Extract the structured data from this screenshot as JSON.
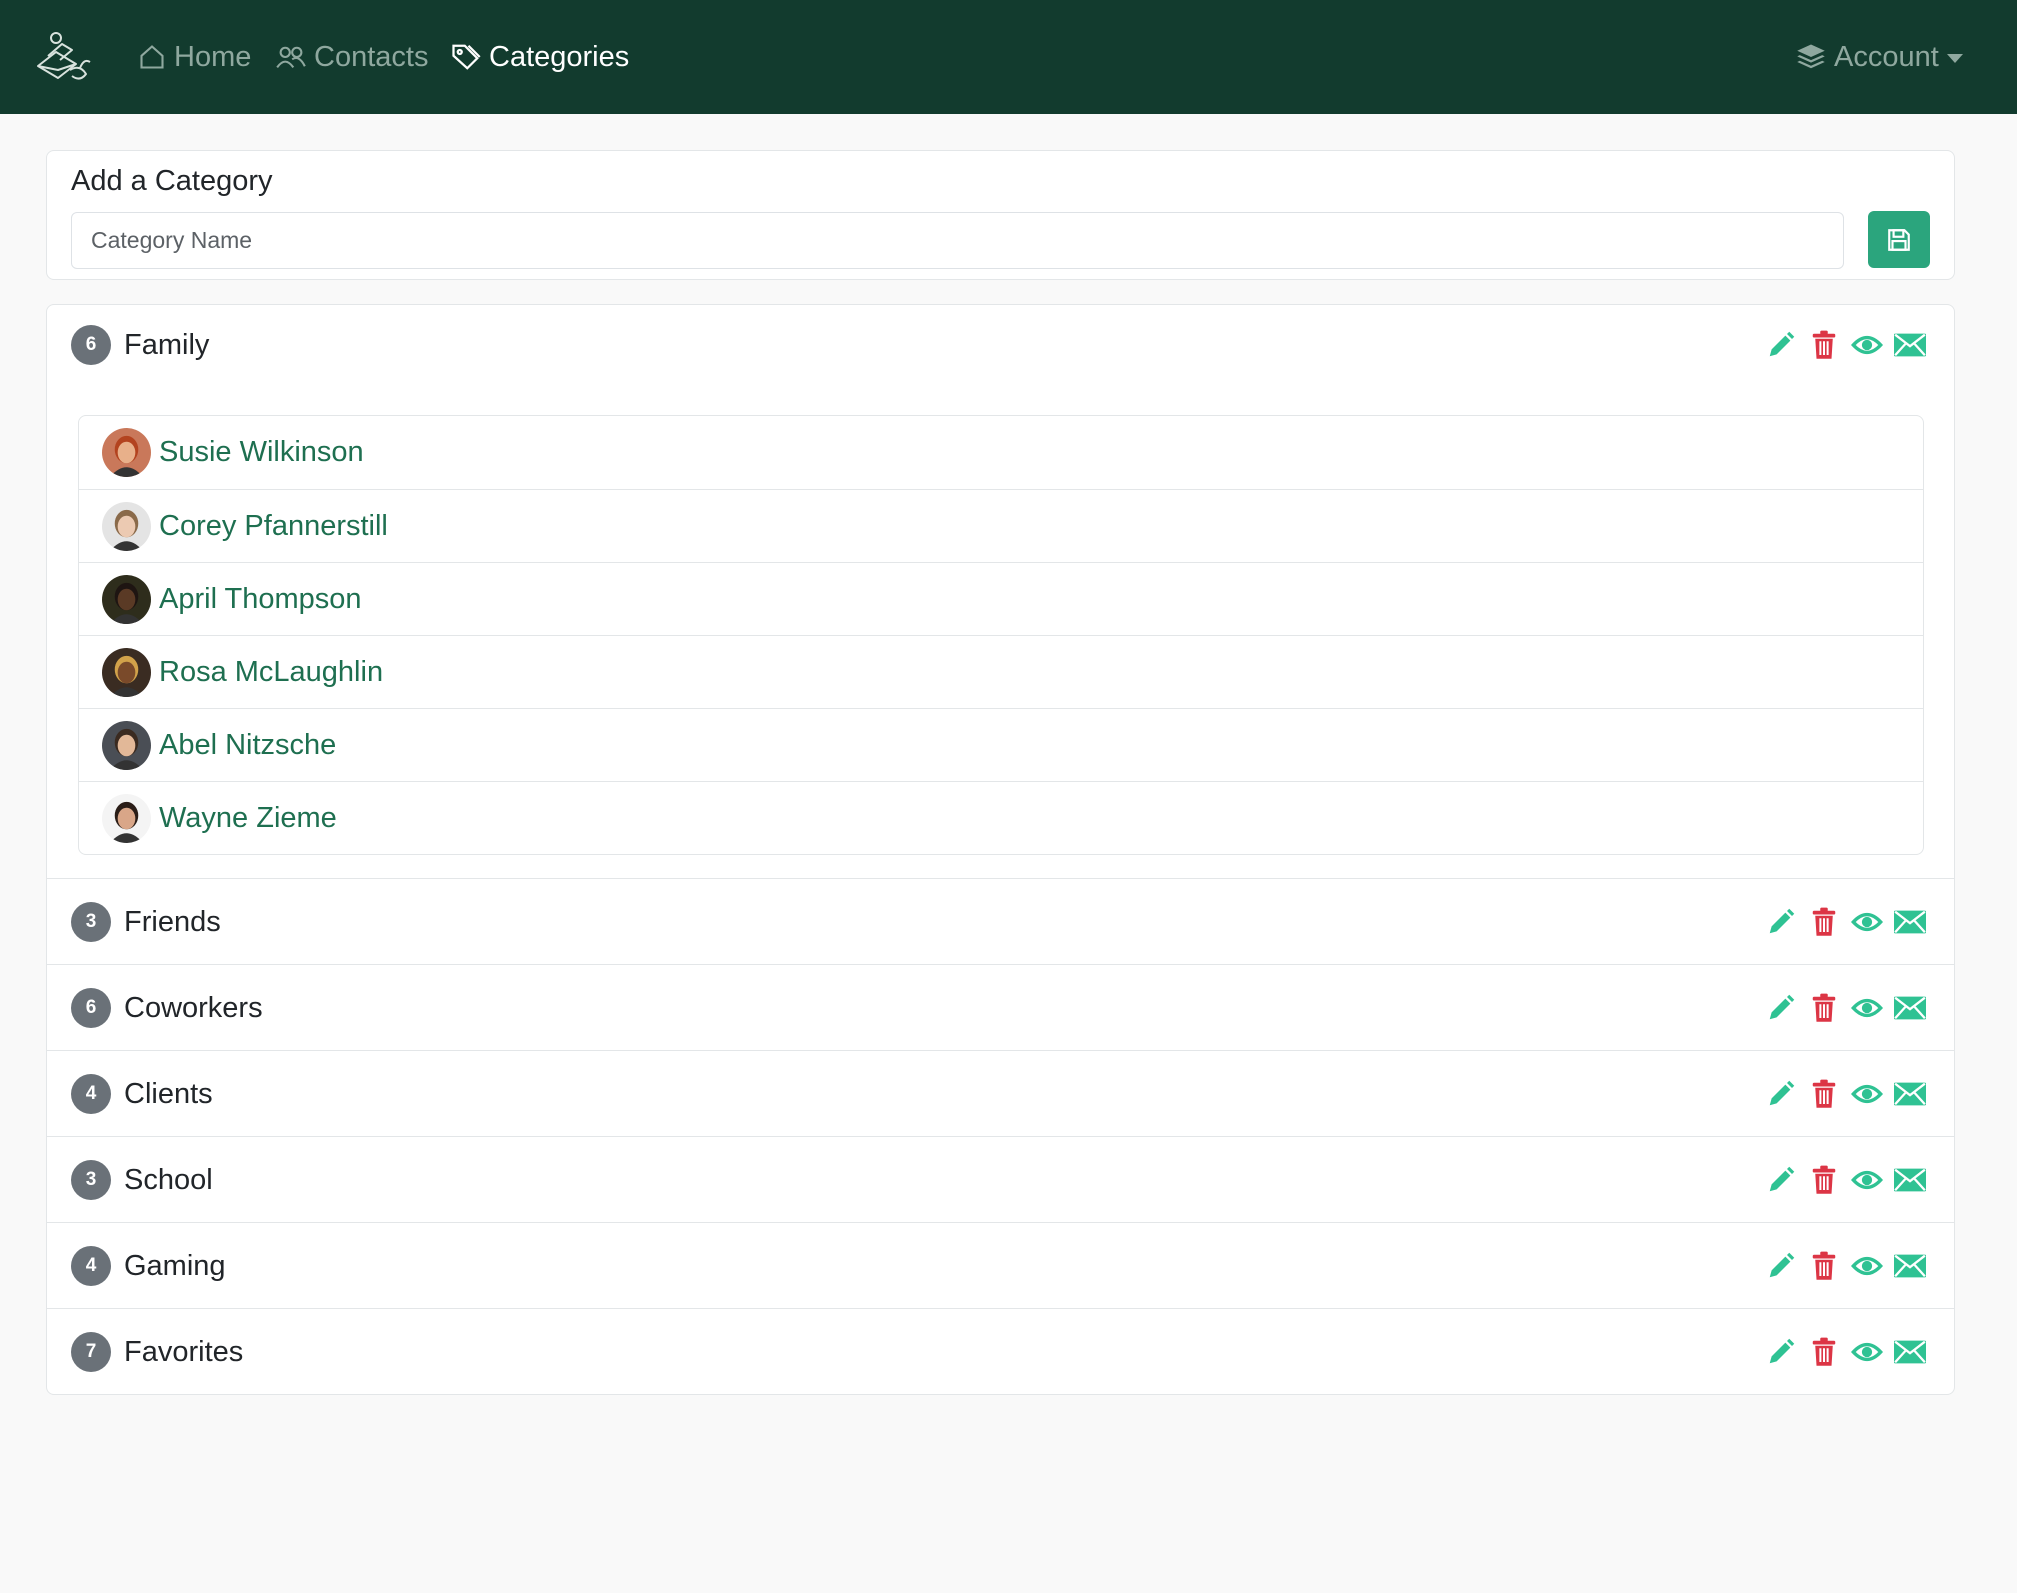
{
  "nav": {
    "home": "Home",
    "contacts": "Contacts",
    "categories": "Categories",
    "account": "Account"
  },
  "add_category": {
    "title": "Add a Category",
    "placeholder": "Category Name",
    "value": ""
  },
  "categories": [
    {
      "name": "Family",
      "count": "6",
      "expanded": true,
      "contacts": [
        {
          "name": "Susie Wilkinson",
          "skin": "#e8b08a",
          "hair": "#b3431f",
          "bg": "#c9785a"
        },
        {
          "name": "Corey Pfannerstill",
          "skin": "#eccab2",
          "hair": "#8a6a4a",
          "bg": "#e4e4e4"
        },
        {
          "name": "April Thompson",
          "skin": "#5a3a25",
          "hair": "#1e1512",
          "bg": "#2e2d1c"
        },
        {
          "name": "Rosa McLaughlin",
          "skin": "#7a4a2a",
          "hair": "#d2a24a",
          "bg": "#3a2c22"
        },
        {
          "name": "Abel Nitzsche",
          "skin": "#e2b898",
          "hair": "#3a2a20",
          "bg": "#4a4e55"
        },
        {
          "name": "Wayne Zieme",
          "skin": "#d9a688",
          "hair": "#2a1d17",
          "bg": "#f4f4f4"
        }
      ]
    },
    {
      "name": "Friends",
      "count": "3",
      "expanded": false
    },
    {
      "name": "Coworkers",
      "count": "6",
      "expanded": false
    },
    {
      "name": "Clients",
      "count": "4",
      "expanded": false
    },
    {
      "name": "School",
      "count": "3",
      "expanded": false
    },
    {
      "name": "Gaming",
      "count": "4",
      "expanded": false
    },
    {
      "name": "Favorites",
      "count": "7",
      "expanded": false
    }
  ],
  "icons": {
    "edit": "pencil-icon",
    "delete": "trash-icon",
    "view": "eye-icon",
    "email": "envelope-icon",
    "save": "floppy-disk-icon"
  },
  "colors": {
    "navbar": "#123b2e",
    "accent": "#2ba57d",
    "action_green": "#2fc293",
    "delete_red": "#dc3545",
    "link": "#1e6f50",
    "badge": "#6a7178"
  }
}
